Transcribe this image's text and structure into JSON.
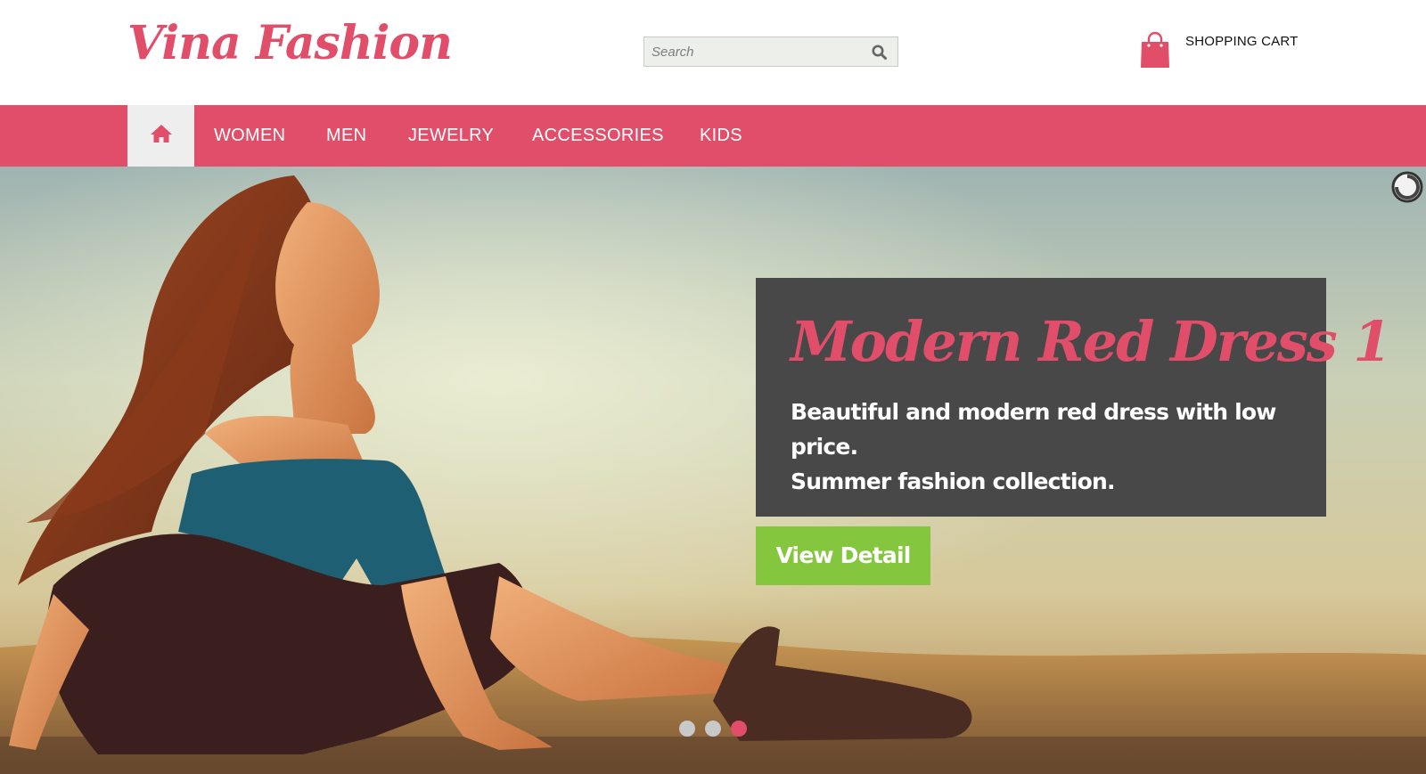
{
  "header": {
    "logo": "Vina Fashion",
    "search": {
      "placeholder": "Search",
      "value": "",
      "icon": "search-icon"
    },
    "cart": {
      "label": "SHOPPING CART",
      "icon": "shopping-bag-icon"
    }
  },
  "nav": {
    "home_icon": "home-icon",
    "items": [
      {
        "label": "WOMEN"
      },
      {
        "label": "MEN"
      },
      {
        "label": "JEWELRY"
      },
      {
        "label": "ACCESSORIES"
      },
      {
        "label": "KIDS"
      }
    ]
  },
  "slider": {
    "title": "Modern Red Dress 1",
    "description_line1": "Beautiful and modern red dress with low price.",
    "description_line2": "Summer fashion collection.",
    "button_label": "View Detail",
    "slide_count": 3,
    "active_slide": 3,
    "loading_indicator_icon": "loading-spinner-icon"
  },
  "colors": {
    "brand": "#e04e6a",
    "nav_background": "#e04e6a",
    "home_tab_background": "#eeeeee",
    "caption_background": "#484848",
    "button_green": "#85c63f",
    "dot_inactive": "#c7c9cb",
    "dot_active": "#e04e6a"
  }
}
